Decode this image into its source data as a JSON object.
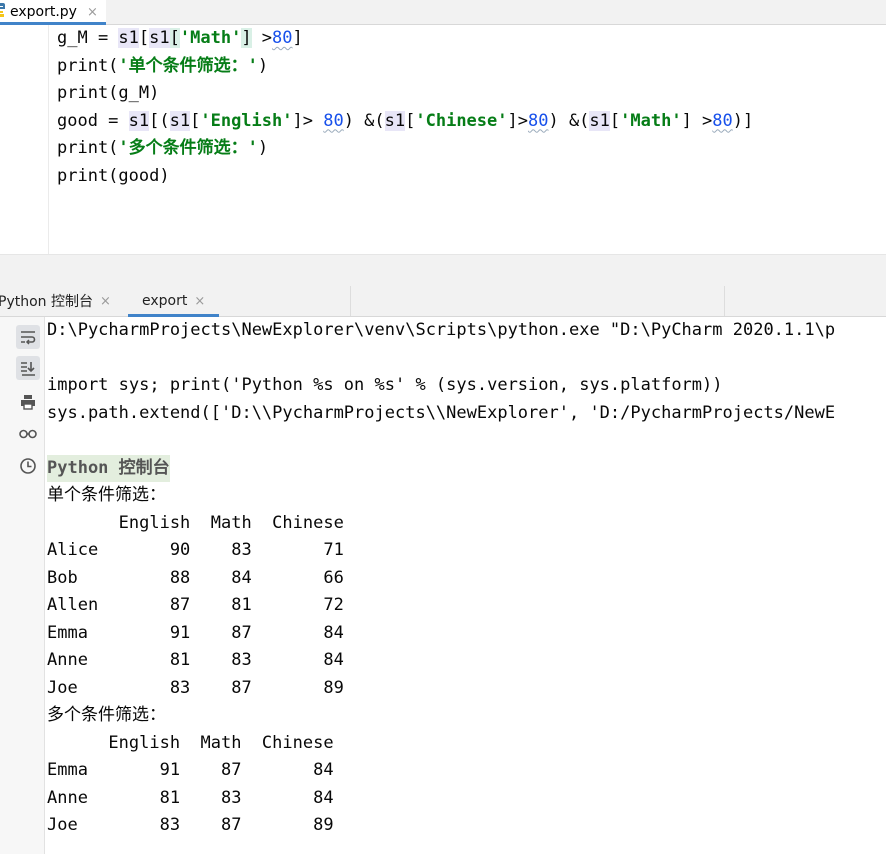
{
  "editor": {
    "tab": {
      "label": "export.py",
      "close": "×"
    },
    "lines": [
      {
        "segments": [
          {
            "t": "g_M = ",
            "c": ""
          },
          {
            "t": "s1",
            "c": "var"
          },
          {
            "t": "[",
            "c": ""
          },
          {
            "t": "s1",
            "c": "var"
          },
          {
            "t": "[",
            "c": "bracket"
          },
          {
            "t": "'Math'",
            "c": "str"
          },
          {
            "t": "]",
            "c": "bracket"
          },
          {
            "t": " >",
            "c": ""
          },
          {
            "t": "80",
            "c": "num"
          },
          {
            "t": "]",
            "c": ""
          }
        ]
      },
      {
        "segments": [
          {
            "t": "print(",
            "c": ""
          },
          {
            "t": "'单个条件筛选：'",
            "c": "str"
          },
          {
            "t": ")",
            "c": ""
          }
        ]
      },
      {
        "segments": [
          {
            "t": "print(g_M)",
            "c": ""
          }
        ]
      },
      {
        "segments": [
          {
            "t": "good = ",
            "c": ""
          },
          {
            "t": "s1",
            "c": "var"
          },
          {
            "t": "[(",
            "c": ""
          },
          {
            "t": "s1",
            "c": "var"
          },
          {
            "t": "[",
            "c": ""
          },
          {
            "t": "'English'",
            "c": "str"
          },
          {
            "t": "]> ",
            "c": ""
          },
          {
            "t": "80",
            "c": "num"
          },
          {
            "t": ") &(",
            "c": ""
          },
          {
            "t": "s1",
            "c": "var"
          },
          {
            "t": "[",
            "c": ""
          },
          {
            "t": "'Chinese'",
            "c": "str"
          },
          {
            "t": "]>",
            "c": ""
          },
          {
            "t": "80",
            "c": "num"
          },
          {
            "t": ") &(",
            "c": ""
          },
          {
            "t": "s1",
            "c": "var"
          },
          {
            "t": "[",
            "c": ""
          },
          {
            "t": "'Math'",
            "c": "str"
          },
          {
            "t": "] >",
            "c": ""
          },
          {
            "t": "80",
            "c": "num"
          },
          {
            "t": ")]",
            "c": ""
          }
        ]
      },
      {
        "segments": [
          {
            "t": "print(",
            "c": ""
          },
          {
            "t": "'多个条件筛选：'",
            "c": "str"
          },
          {
            "t": ")",
            "c": ""
          }
        ]
      },
      {
        "segments": [
          {
            "t": "print(good)",
            "c": ""
          }
        ]
      }
    ]
  },
  "run_panel": {
    "tabs": [
      {
        "label": "Python 控制台",
        "close": "×"
      },
      {
        "label": "export",
        "close": "×",
        "active": true
      }
    ],
    "toolbar_icons": [
      "soft-wrap-icon",
      "scroll-to-end-icon",
      "print-icon",
      "view-variables-icon",
      "history-icon"
    ],
    "console_lines": [
      {
        "text": "D:\\PycharmProjects\\NewExplorer\\venv\\Scripts\\python.exe \"D:\\PyCharm 2020.1.1\\p",
        "kind": "cmd"
      },
      {
        "text": "",
        "kind": "blank"
      },
      {
        "text": "import sys; print('Python %s on %s' % (sys.version, sys.platform))",
        "kind": "cmd"
      },
      {
        "text": "sys.path.extend(['D:\\\\PycharmProjects\\\\NewExplorer', 'D:/PycharmProjects/NewE",
        "kind": "cmd"
      },
      {
        "text": "",
        "kind": "blank"
      },
      {
        "text": "Python 控制台",
        "kind": "prompt"
      },
      {
        "text": "单个条件筛选：",
        "kind": "cjk"
      },
      {
        "text": "       English  Math  Chinese",
        "kind": "out"
      },
      {
        "text": "Alice       90    83       71",
        "kind": "out"
      },
      {
        "text": "Bob         88    84       66",
        "kind": "out"
      },
      {
        "text": "Allen       87    81       72",
        "kind": "out"
      },
      {
        "text": "Emma        91    87       84",
        "kind": "out"
      },
      {
        "text": "Anne        81    83       84",
        "kind": "out"
      },
      {
        "text": "Joe         83    87       89",
        "kind": "out"
      },
      {
        "text": "多个条件筛选：",
        "kind": "cjk"
      },
      {
        "text": "      English  Math  Chinese",
        "kind": "out"
      },
      {
        "text": "Emma       91    87       84",
        "kind": "out"
      },
      {
        "text": "Anne       81    83       84",
        "kind": "out"
      },
      {
        "text": "Joe        83    87       89",
        "kind": "out"
      }
    ]
  },
  "colors": {
    "accent": "#4083c9",
    "string": "#067d17",
    "number": "#1750eb",
    "prompt_bg": "#e3eede"
  }
}
